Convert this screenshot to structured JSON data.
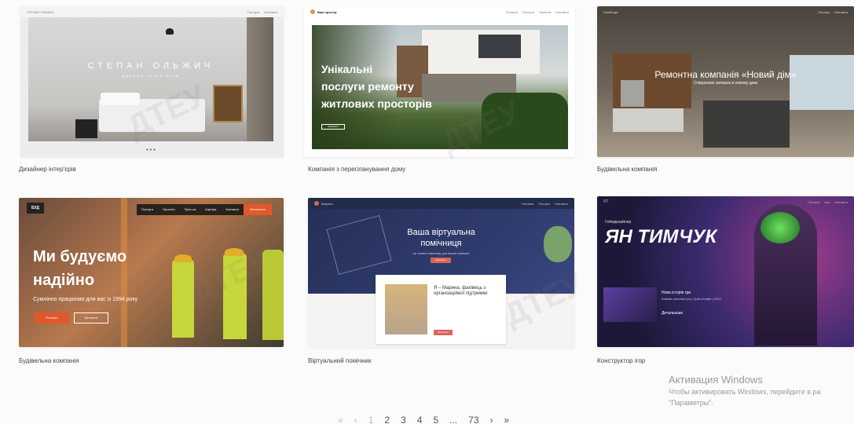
{
  "cards": [
    {
      "caption": "Дизайнер інтер'єрів",
      "title": "СТЕПАН ОЛЬЖИЧ",
      "subtitle": "ДИЗАЙН ІНТЕР'ЄРІВ",
      "brand": "СТЕПАН ОЛЬЖИЧ"
    },
    {
      "caption": "Компанія з перепланування дому",
      "title_line1": "Унікальні",
      "title_line2": "послуги ремонту",
      "title_line3": "житлових просторів",
      "brand": "Ваш простір",
      "button": "Замовити"
    },
    {
      "caption": "Будівельна компанія",
      "title": "Ремонтна компанія «Новий дім»",
      "subtitle": "Створюємо затишок в новому домі"
    },
    {
      "caption": "Будівельна компанія",
      "logo": "БУД",
      "title_line1": "Ми будуємо",
      "title_line2": "надійно",
      "subtitle": "Сумлінно працюємо для вас із 1994 року",
      "nav": [
        "Послуги",
        "Проекти",
        "Прес-ка",
        "Кар'єра",
        "Контакти"
      ],
      "nav_cta": "Зв'язатися",
      "button1": "Послуги",
      "button2": "Контакти"
    },
    {
      "caption": "Віртуальний помічник",
      "title_line1": "Ваша віртуальна",
      "title_line2": "помічниця",
      "subtitle": "Це назва помічниці для вашої компанії",
      "button": "Замовити",
      "bio_title": "Я – Марина, фахівець з організаційної підтримки",
      "bio_button": "Замовити"
    },
    {
      "caption": "Конструктор ігор",
      "title": "ЯН ТИМЧУК",
      "subtitle": "Геймдизайнер",
      "game_title": "Нова історія гри",
      "game_meta": "Бойова система гри | Грай онлайн | 2022",
      "game_button": "Детальніше"
    }
  ],
  "pagination": {
    "prev2": "«",
    "prev": "‹",
    "p1": "1",
    "p2": "2",
    "p3": "3",
    "p4": "4",
    "p5": "5",
    "dots": "...",
    "last": "73",
    "next": "›",
    "next2": "»"
  },
  "windows": {
    "title": "Активация Windows",
    "line1": "Чтобы активировать Windows, перейдите в ра",
    "line2": "\"Параметры\"."
  }
}
